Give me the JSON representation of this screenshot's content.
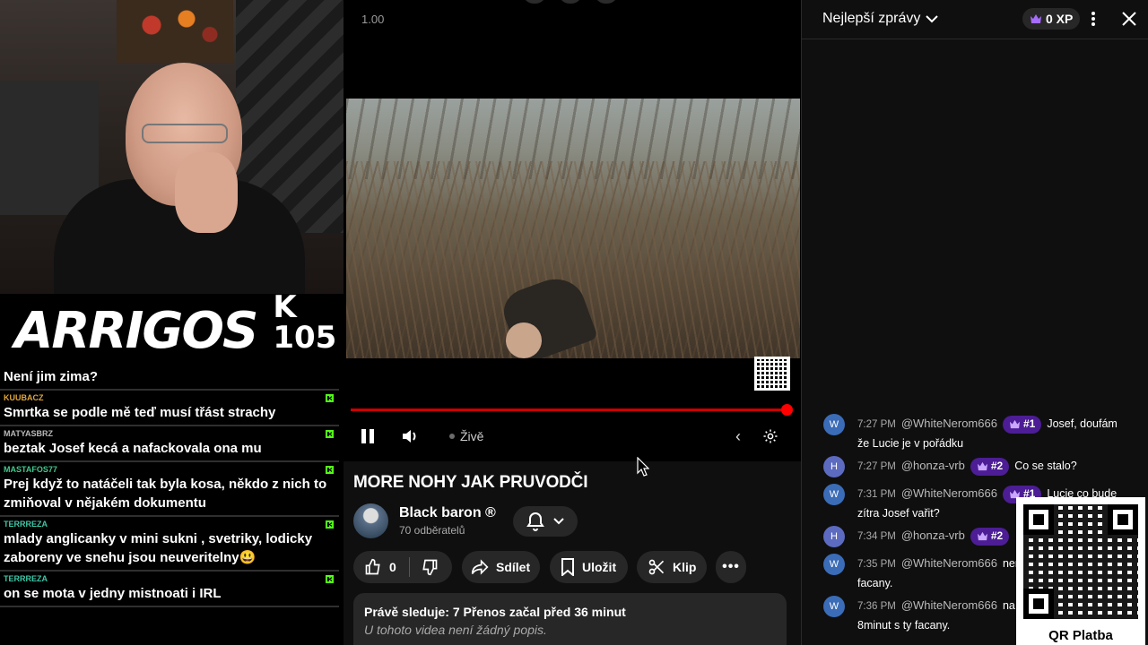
{
  "overlay": {
    "brand": "ARRIGOS",
    "level": "K 105",
    "messages": [
      {
        "user": "",
        "text": "Není jim zima?",
        "user_color": "#ffffff"
      },
      {
        "user": "KUUBACZ",
        "text": "Smrtka se podle mě teď musí třást strachy",
        "user_color": "#e0a63a"
      },
      {
        "user": "MATYASBRZ",
        "text": "beztak Josef kecá a nafackovala ona mu",
        "user_color": "#b9b9b9"
      },
      {
        "user": "MASTAFOS77",
        "text": "Prej když to natáčeli tak byla kosa, někdo z nich to zmiňoval v nějakém dokumentu",
        "user_color": "#41c98c"
      },
      {
        "user": "TERRREZA",
        "text": "mlady anglicanky v mini sukni , svetriky, lodicky zaboreny ve snehu jsou neuveritelny😃",
        "user_color": "#3fc7a7"
      },
      {
        "user": "TERRREZA",
        "text": "on se mota v jedny mistnoati i IRL",
        "user_color": "#3fc7a7"
      }
    ]
  },
  "player": {
    "speed": "1.00",
    "live_label": "Živě",
    "progress": 1.0
  },
  "video": {
    "title": "MORE NOHY JAK PRUVODČI",
    "channel": "Black baron ®",
    "subscribers": "70 odběratelů",
    "likes": "0",
    "share_label": "Sdílet",
    "save_label": "Uložit",
    "clip_label": "Klip",
    "stats": "Právě sleduje: 7  Přenos začal před 36 minut",
    "description": "U tohoto videa není žádný popis."
  },
  "chat": {
    "filter_label": "Nejlepší zprávy",
    "xp": "0 XP",
    "messages": [
      {
        "avatar": "W",
        "avatar_color": "#3b6cb7",
        "time": "7:27 PM",
        "author": "@WhiteNerom666",
        "badge": "#1",
        "text": "Josef, doufám že Lucie je v pořádku"
      },
      {
        "avatar": "H",
        "avatar_color": "#5c6bc0",
        "time": "7:27 PM",
        "author": "@honza-vrb",
        "badge": "#2",
        "text": "Co se stalo?"
      },
      {
        "avatar": "W",
        "avatar_color": "#3b6cb7",
        "time": "7:31 PM",
        "author": "@WhiteNerom666",
        "badge": "#1",
        "text": "Lucie co bude zítra Josef vařit?"
      },
      {
        "avatar": "H",
        "avatar_color": "#5c6bc0",
        "time": "7:34 PM",
        "author": "@honza-vrb",
        "badge": "#2",
        "text": ""
      },
      {
        "avatar": "W",
        "avatar_color": "#3b6cb7",
        "time": "7:35 PM",
        "author": "@WhiteNerom666",
        "badge": "",
        "text": "nenapsali,padly čtyři facany."
      },
      {
        "avatar": "W",
        "avatar_color": "#3b6cb7",
        "time": "7:36 PM",
        "author": "@WhiteNerom666",
        "badge": "",
        "text": "na .jutubu, posledních 8minut s ty facany."
      }
    ],
    "qr_caption": "QR Platba"
  },
  "icons": [
    "pause-icon",
    "volume-icon",
    "chevron-left-icon",
    "settings-icon",
    "bell-icon",
    "chevron-down-icon",
    "thumbs-up-icon",
    "thumbs-down-icon",
    "share-icon",
    "bookmark-icon",
    "scissors-icon",
    "more-icon",
    "crown-icon",
    "kebab-icon",
    "close-icon",
    "qr-code-icon"
  ]
}
